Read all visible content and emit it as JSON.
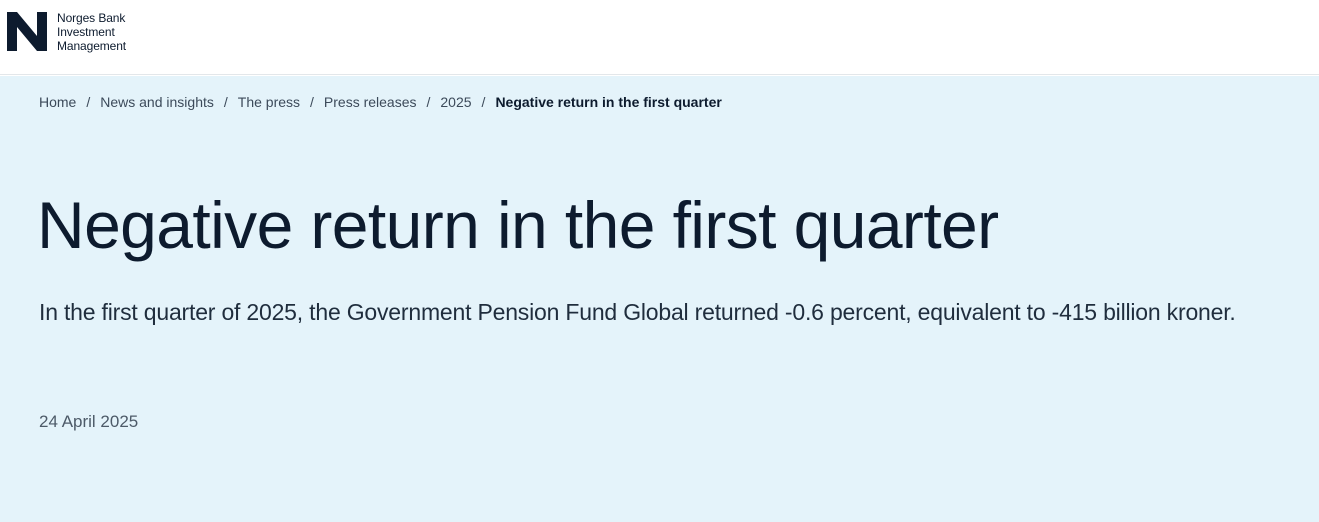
{
  "brand": {
    "name_line1": "Norges Bank",
    "name_line2": "Investment",
    "name_line3": "Management",
    "logo_color": "#0d1b2e"
  },
  "breadcrumb": {
    "items": [
      "Home",
      "News and insights",
      "The press",
      "Press releases",
      "2025"
    ],
    "separator": "/",
    "current": "Negative return in the first quarter"
  },
  "article": {
    "title": "Negative return in the first quarter",
    "lead": "In the first quarter of 2025, the Government Pension Fund Global returned -0.6 percent, equivalent to -415 billion kroner.",
    "date": "24 April 2025"
  },
  "colors": {
    "hero_background": "#e4f3fa",
    "text_primary": "#0d1b2e"
  }
}
